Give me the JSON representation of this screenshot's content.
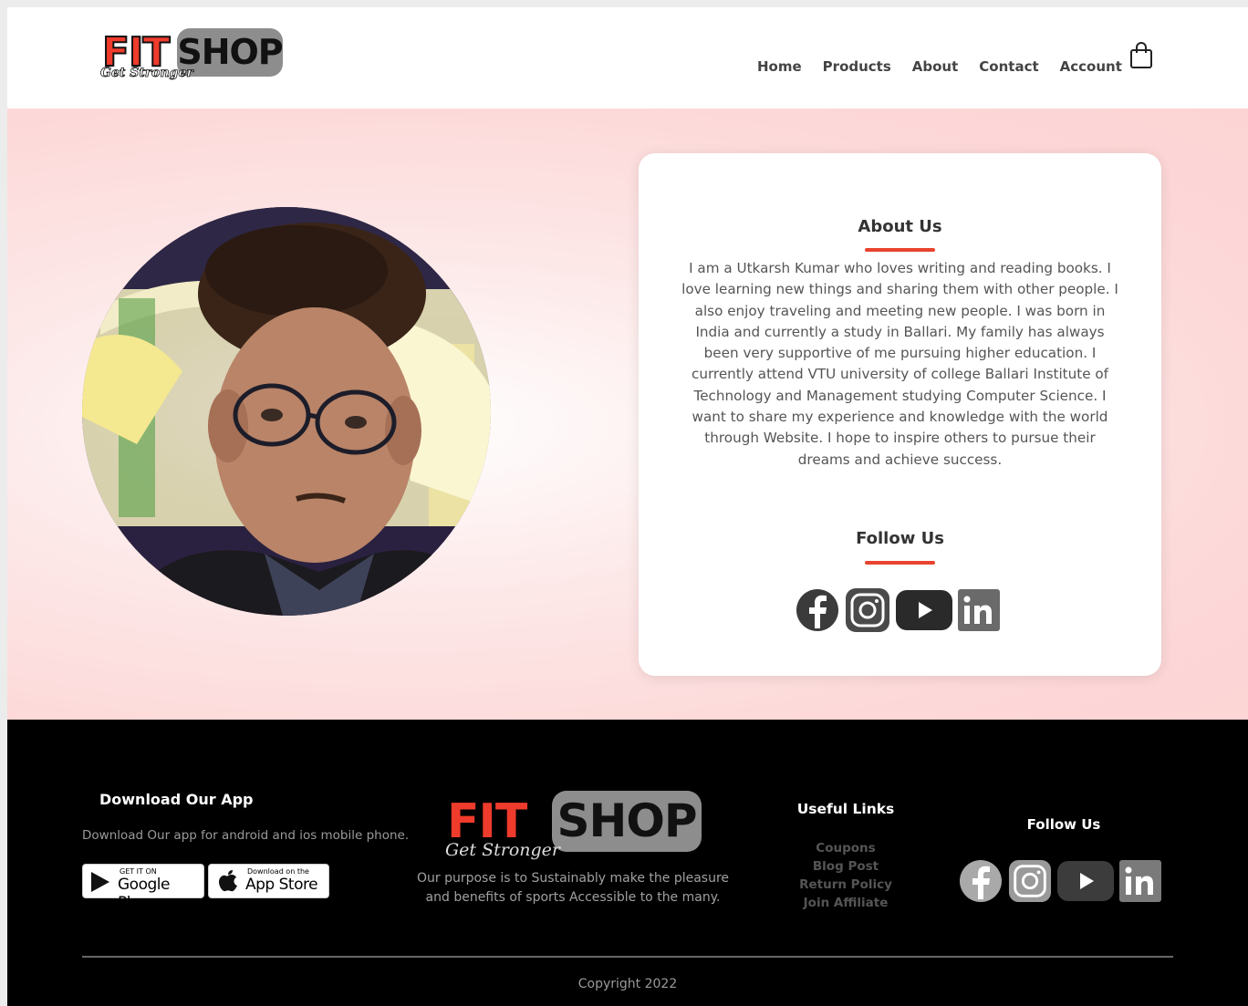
{
  "brand": {
    "logo_fit": "FIT",
    "logo_shop": "SHOP",
    "logo_tagline": "Get Stronger"
  },
  "nav": {
    "items": [
      "Home",
      "Products",
      "About",
      "Contact",
      "Account"
    ],
    "cart_icon": "shopping-bag-icon"
  },
  "about": {
    "title": "About Us",
    "body": "I am a Utkarsh Kumar who loves writing and reading books. I love learning new things and sharing them with other people. I also enjoy traveling and meeting new people. I was born in India and currently a study in Ballari. My family has always been very supportive of me pursuing higher education. I currently attend VTU university of college Ballari Institute of Technology and Management studying Computer Science. I want to share my experience and knowledge with the world through Website. I hope to inspire others to pursue their dreams and achieve success.",
    "follow_title": "Follow Us",
    "social_icons": [
      "facebook-icon",
      "instagram-icon",
      "youtube-icon",
      "linkedin-icon"
    ]
  },
  "footer": {
    "app_title": "Download Our App",
    "app_text": "Download Our app for android and ios mobile phone.",
    "google_play_small": "GET IT ON",
    "google_play_big": "Google Play",
    "app_store_small": "Download on the",
    "app_store_big": "App Store",
    "purpose": "Our purpose is to Sustainably make the pleasure and benefits of sports Accessible to the many.",
    "useful_links_title": "Useful Links",
    "useful_links": [
      "Coupons",
      "Blog Post",
      "Return Policy",
      "Join Affiliate"
    ],
    "follow_title": "Follow Us",
    "copyright": "Copyright 2022"
  },
  "colors": {
    "accent": "#e8432e",
    "hero_bg": "#fdd8d8",
    "footer_bg": "#000000"
  }
}
